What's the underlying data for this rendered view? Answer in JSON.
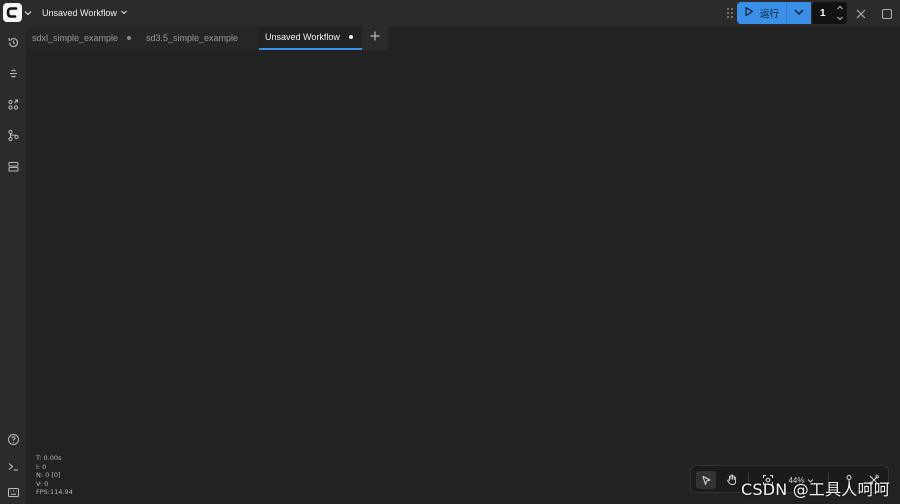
{
  "header": {
    "workflow_title": "Unsaved Workflow",
    "run_label": "运行",
    "batch_count": "1",
    "accent_color": "#3b8fe6"
  },
  "tabs": [
    {
      "label": "sdxl_simple_example",
      "modified": true,
      "active": false
    },
    {
      "label": "sd3.5_simple_example",
      "modified": false,
      "active": false
    },
    {
      "label": "Unsaved Workflow",
      "modified": true,
      "active": true
    }
  ],
  "sidebar": {
    "top_icons": [
      "history-icon",
      "queue-icon",
      "node-library-icon",
      "model-library-icon",
      "workflows-icon"
    ],
    "bottom_icons": [
      "help-icon",
      "terminal-icon",
      "keyboard-icon"
    ]
  },
  "stats": {
    "t": "T: 0.00s",
    "i": "I: 0",
    "n": "N: 0 [0]",
    "v": "V: 0",
    "fps": "FPS:114.94"
  },
  "canvas_toolbar": {
    "zoom": "44%"
  },
  "watermark": "CSDN @工具人呵呵"
}
